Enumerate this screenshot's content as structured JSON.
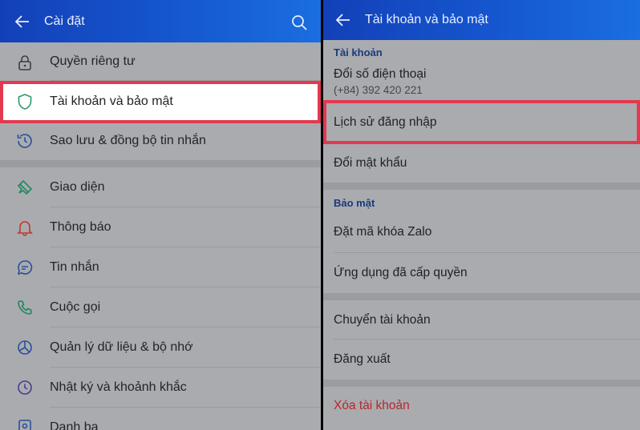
{
  "left": {
    "title": "Cài đặt",
    "items": [
      {
        "label": "Quyền riêng tư",
        "icon": "lock-icon"
      },
      {
        "label": "Tài khoản và bảo mật",
        "icon": "shield-icon"
      },
      {
        "label": "Sao lưu & đồng bộ tin nhắn",
        "icon": "history-icon"
      },
      {
        "label": "Giao diện",
        "icon": "paint-brush-icon"
      },
      {
        "label": "Thông báo",
        "icon": "bell-icon"
      },
      {
        "label": "Tin nhắn",
        "icon": "chat-icon"
      },
      {
        "label": "Cuộc gọi",
        "icon": "phone-icon"
      },
      {
        "label": "Quản lý dữ liệu & bộ nhớ",
        "icon": "pie-chart-icon"
      },
      {
        "label": "Nhật ký và khoảnh khắc",
        "icon": "clock-icon"
      },
      {
        "label": "Danh bạ",
        "icon": "contacts-icon"
      }
    ]
  },
  "right": {
    "title": "Tài khoản và bảo mật",
    "section_account": "Tài khoản",
    "change_phone": "Đổi số điện thoại",
    "phone_number": "(+84) 392 420 221",
    "login_history": "Lịch sử đăng nhập",
    "change_password": "Đổi mật khẩu",
    "section_security": "Bảo mật",
    "set_lock": "Đặt mã khóa Zalo",
    "authorized_apps": "Ứng dụng đã cấp quyền",
    "switch_account": "Chuyển tài khoản",
    "logout": "Đăng xuất",
    "delete_account": "Xóa tài khoản"
  },
  "colors": {
    "header": "#1557cf",
    "highlight_border": "#e2394f",
    "icon_green": "#1f8a5b",
    "icon_red": "#c0392b",
    "icon_blue": "#2a4f9a"
  }
}
